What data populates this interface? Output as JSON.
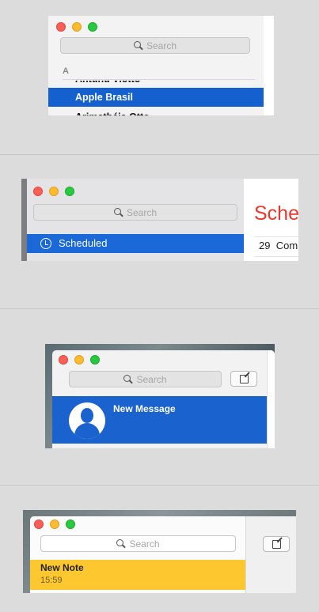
{
  "contacts_window": {
    "search": {
      "placeholder": "Search"
    },
    "section_letter": "A",
    "rows": [
      {
        "label": "Antunu Viotto",
        "selected": false
      },
      {
        "label": "Apple Brasil",
        "selected": true
      },
      {
        "label": "Arimathéia Otto",
        "selected": false
      }
    ]
  },
  "reminders_window": {
    "search": {
      "placeholder": "Search"
    },
    "selected_list": {
      "label": "Scheduled",
      "icon": "alarm-clock-icon"
    },
    "content": {
      "heading": "Scheduled",
      "count": "29",
      "item": "Com"
    }
  },
  "messages_window": {
    "search": {
      "placeholder": "Search"
    },
    "compose_icon": "compose-icon",
    "conversation": {
      "title": "New Message",
      "avatar": "person-silhouette-icon"
    }
  },
  "notes_window": {
    "search": {
      "placeholder": "Search"
    },
    "compose_icon": "compose-icon",
    "note": {
      "title": "New Note",
      "time": "15:59"
    }
  },
  "colors": {
    "selection_blue": "#1560cf",
    "note_yellow": "#fdc82f",
    "reminder_red": "#e8382e"
  }
}
